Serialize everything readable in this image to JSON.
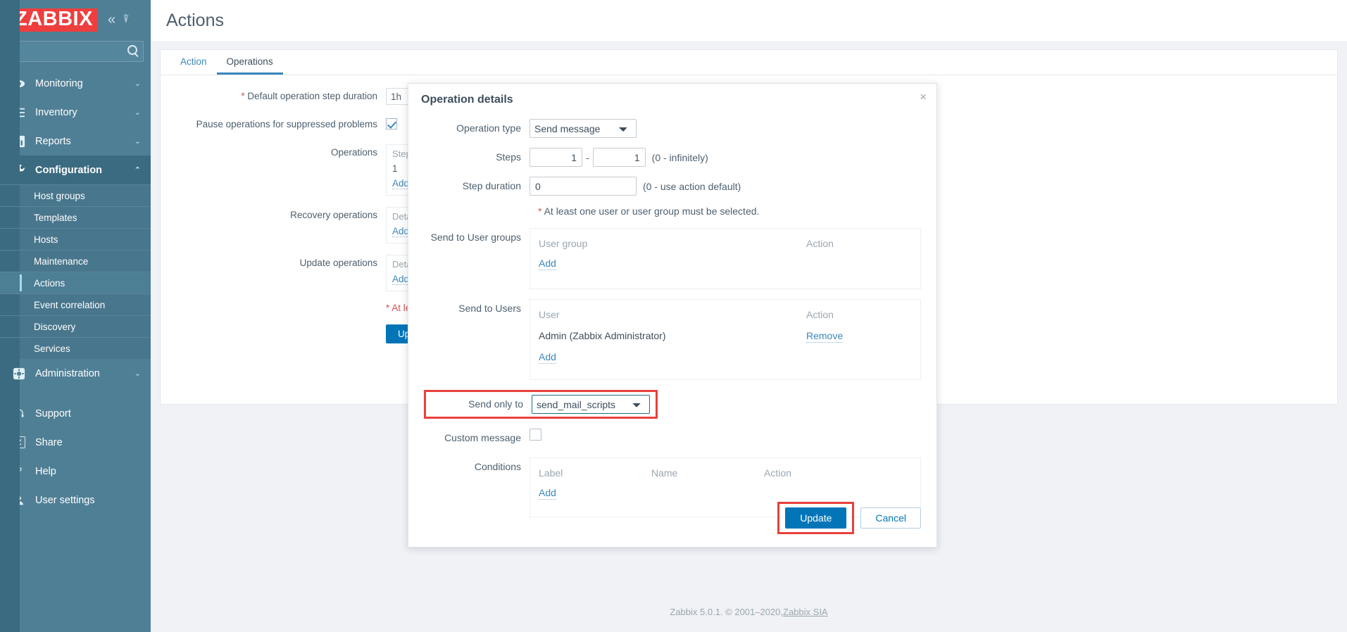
{
  "sidebar": {
    "logo": "ZABBIX",
    "collapse_icon": "chevron-double-left-icon",
    "compact_icon": "collapse-pane-icon",
    "search": {
      "value": "",
      "placeholder": ""
    },
    "nav": [
      {
        "label": "Monitoring",
        "icon": "eye-icon",
        "arrow": "⌄",
        "selected": false
      },
      {
        "label": "Inventory",
        "icon": "list-icon",
        "arrow": "⌄",
        "selected": false
      },
      {
        "label": "Reports",
        "icon": "bar-chart-icon",
        "arrow": "⌄",
        "selected": false
      },
      {
        "label": "Configuration",
        "icon": "wrench-icon",
        "arrow": "⌃",
        "selected": true
      }
    ],
    "submenu": [
      {
        "label": "Host groups",
        "active": false
      },
      {
        "label": "Templates",
        "active": false
      },
      {
        "label": "Hosts",
        "active": false
      },
      {
        "label": "Maintenance",
        "active": false
      },
      {
        "label": "Actions",
        "active": true
      },
      {
        "label": "Event correlation",
        "active": false
      },
      {
        "label": "Discovery",
        "active": false
      },
      {
        "label": "Services",
        "active": false
      }
    ],
    "nav_admin": {
      "label": "Administration",
      "icon": "gear-box-icon",
      "arrow": "⌄"
    },
    "footer_items": [
      {
        "label": "Support",
        "icon": "headset-icon"
      },
      {
        "label": "Share",
        "icon": "z-badge-icon"
      },
      {
        "label": "Help",
        "icon": "question-mark-icon"
      },
      {
        "label": "User settings",
        "icon": "user-icon"
      }
    ]
  },
  "header": {
    "title": "Actions"
  },
  "tabs": [
    {
      "label": "Action",
      "active": false
    },
    {
      "label": "Operations",
      "active": true
    }
  ],
  "background_form": {
    "default_step_duration": {
      "label": "Default operation step duration",
      "required": true,
      "value": "1h"
    },
    "pause_suppressed": {
      "label": "Pause operations for suppressed problems",
      "checked": true
    },
    "operations": {
      "label": "Operations",
      "header": "Steps",
      "row": "1",
      "add": "Add"
    },
    "recovery_operations": {
      "label": "Recovery operations",
      "header": "Deta",
      "add": "Add"
    },
    "update_operations": {
      "label": "Update operations",
      "header": "Deta",
      "add": "Add"
    },
    "note": "* At least on",
    "update_button": "Update"
  },
  "modal": {
    "title": "Operation details",
    "close": "×",
    "operation_type": {
      "label": "Operation type",
      "value": "Send message",
      "options": [
        "Send message"
      ]
    },
    "steps": {
      "label": "Steps",
      "from": "1",
      "to": "1",
      "separator": "-",
      "hint": "(0 - infinitely)"
    },
    "step_duration": {
      "label": "Step duration",
      "value": "0",
      "hint": "(0 - use action default)"
    },
    "required_note": {
      "star": "*",
      "text": "At least one user or user group must be selected."
    },
    "send_to_user_groups": {
      "label": "Send to User groups",
      "columns": [
        "User group",
        "Action"
      ],
      "rows": [],
      "add": "Add"
    },
    "send_to_users": {
      "label": "Send to Users",
      "columns": [
        "User",
        "Action"
      ],
      "rows": [
        {
          "user": "Admin (Zabbix Administrator)",
          "action": "Remove"
        }
      ],
      "add": "Add"
    },
    "send_only_to": {
      "label": "Send only to",
      "value": "send_mail_scripts",
      "options": [
        "send_mail_scripts"
      ],
      "highlighted": true
    },
    "custom_message": {
      "label": "Custom message",
      "checked": false
    },
    "conditions": {
      "label": "Conditions",
      "columns": [
        "Label",
        "Name",
        "Action"
      ],
      "rows": [],
      "add": "Add"
    },
    "buttons": {
      "update": "Update",
      "cancel": "Cancel",
      "update_highlighted": true
    }
  },
  "footer": {
    "text": "Zabbix 5.0.1. © 2001–2020, ",
    "link": "Zabbix SIA"
  },
  "colors": {
    "sidebar": "#4f7f95",
    "sidebar_selected": "#3b6b80",
    "logo_red": "#ee3e3e",
    "accent_blue": "#0275b8",
    "link_blue": "#3a87bd",
    "highlight_red": "#e8413c",
    "required_red": "#d45353",
    "focus_teal": "#1d6f85"
  }
}
